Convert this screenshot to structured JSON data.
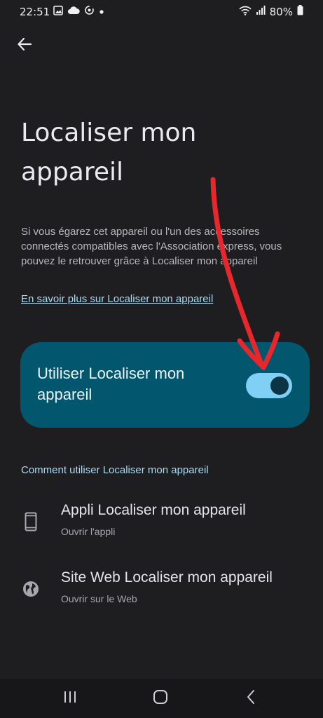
{
  "status_bar": {
    "time": "22:51",
    "battery": "80%",
    "left_icons": [
      "image-icon",
      "cloud-icon",
      "sync-icon",
      "dot-icon"
    ],
    "right_icons": [
      "wifi-icon",
      "signal-icon",
      "battery-icon"
    ]
  },
  "header": {
    "back_icon": "arrow-back-icon",
    "title": "Localiser mon appareil"
  },
  "description": "Si vous égarez cet appareil ou l'un des accessoires connectés compatibles avec l'Association express, vous pouvez le retrouver grâce à Localiser mon appareil",
  "learn_more_link": "En savoir plus sur Localiser mon appareil",
  "main_toggle": {
    "label": "Utiliser Localiser mon appareil",
    "enabled": true
  },
  "section": {
    "header": "Comment utiliser Localiser mon appareil",
    "items": [
      {
        "icon": "phone-icon",
        "title": "Appli Localiser mon appareil",
        "subtitle": "Ouvrir l'appli"
      },
      {
        "icon": "globe-icon",
        "title": "Site Web Localiser mon appareil",
        "subtitle": "Ouvrir sur le Web"
      }
    ]
  },
  "nav_bar": {
    "icons": [
      "recents-icon",
      "home-icon",
      "back-nav-icon"
    ]
  },
  "colors": {
    "background": "#1e1e21",
    "card": "#02566e",
    "toggle_track": "#7fd0f4",
    "accent_text": "#a9dbf2",
    "annotation_red": "#e8272c"
  }
}
